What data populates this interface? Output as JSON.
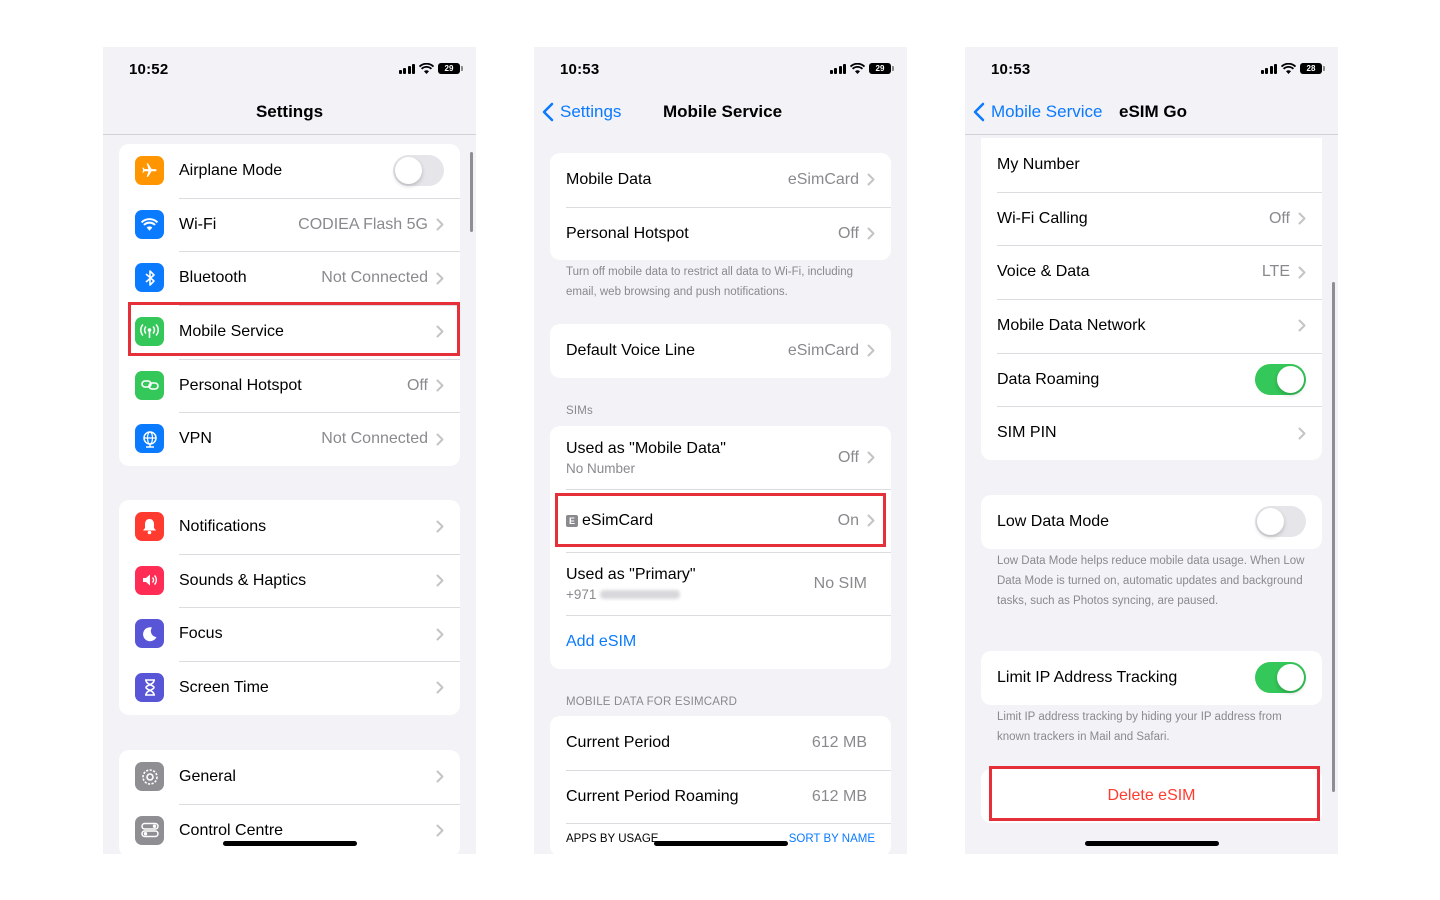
{
  "screen1": {
    "time": "10:52",
    "battery": "29",
    "title": "Settings",
    "group1": [
      {
        "label": "Airplane Mode",
        "value": ""
      },
      {
        "label": "Wi-Fi",
        "value": "CODIEA Flash 5G"
      },
      {
        "label": "Bluetooth",
        "value": "Not Connected"
      },
      {
        "label": "Mobile Service",
        "value": ""
      },
      {
        "label": "Personal Hotspot",
        "value": "Off"
      },
      {
        "label": "VPN",
        "value": "Not Connected"
      }
    ],
    "group2": [
      {
        "label": "Notifications"
      },
      {
        "label": "Sounds & Haptics"
      },
      {
        "label": "Focus"
      },
      {
        "label": "Screen Time"
      }
    ],
    "group3": [
      {
        "label": "General"
      },
      {
        "label": "Control Centre"
      }
    ],
    "colors": {
      "airplane": "#ff9500",
      "wifi": "#0a7aff",
      "bluetooth": "#0a7aff",
      "mobile": "#34c759",
      "hotspot": "#34c759",
      "vpn": "#0a7aff",
      "notifications": "#ff3b30",
      "sounds": "#ff2d55",
      "focus": "#5856d6",
      "screentime": "#5856d6",
      "general": "#8e8e93",
      "control": "#8e8e93"
    }
  },
  "screen2": {
    "time": "10:53",
    "battery": "29",
    "back_label": "Settings",
    "title": "Mobile Service",
    "group1": [
      {
        "label": "Mobile Data",
        "value": "eSimCard"
      },
      {
        "label": "Personal Hotspot",
        "value": "Off"
      }
    ],
    "footnote1": "Turn off mobile data to restrict all data to Wi-Fi, including email, web browsing and push notifications.",
    "default_voice": {
      "label": "Default Voice Line",
      "value": "eSimCard"
    },
    "sims_header": "SIMs",
    "sims": {
      "used_as_data": {
        "label": "Used as \"Mobile Data\"",
        "sub": "No Number",
        "value": "Off"
      },
      "esim_badge": "E",
      "esimcard": {
        "label": "eSimCard",
        "value": "On"
      },
      "primary": {
        "label": "Used as \"Primary\"",
        "sub": "+971",
        "value": "No SIM"
      },
      "add_esim": "Add eSIM"
    },
    "data_header": "MOBILE DATA FOR ESIMCARD",
    "data_rows": [
      {
        "label": "Current Period",
        "value": "612 MB"
      },
      {
        "label": "Current Period Roaming",
        "value": "612 MB"
      }
    ],
    "apps_header": "APPS BY USAGE",
    "sort_label": "SORT BY NAME"
  },
  "screen3": {
    "time": "10:53",
    "battery": "28",
    "back_label": "Mobile Service",
    "title": "eSIM Go",
    "group1": [
      {
        "label": "My Number",
        "value": ""
      },
      {
        "label": "Wi-Fi Calling",
        "value": "Off"
      },
      {
        "label": "Voice & Data",
        "value": "LTE"
      },
      {
        "label": "Mobile Data Network",
        "value": ""
      },
      {
        "label": "Data Roaming",
        "value": ""
      },
      {
        "label": "SIM PIN",
        "value": ""
      }
    ],
    "low_data": {
      "label": "Low Data Mode",
      "enabled": false
    },
    "low_data_note": "Low Data Mode helps reduce mobile data usage. When Low Data Mode is turned on, automatic updates and background tasks, such as Photos syncing, are paused.",
    "limit_ip": {
      "label": "Limit IP Address Tracking",
      "enabled": true
    },
    "limit_ip_note": "Limit IP address tracking by hiding your IP address from known trackers in Mail and Safari.",
    "delete_label": "Delete eSIM",
    "data_roaming_enabled": true
  }
}
